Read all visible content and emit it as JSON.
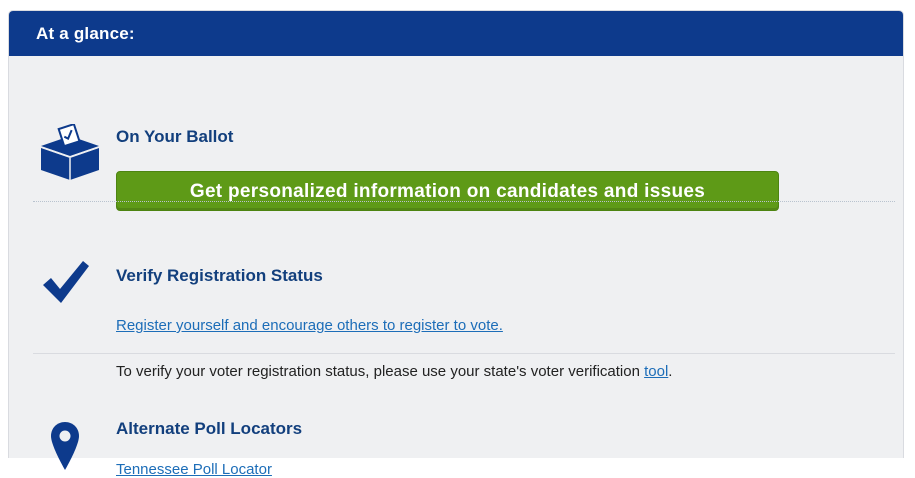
{
  "header": {
    "title": "At a glance:"
  },
  "ballot": {
    "icon": "ballot-box-icon",
    "title": "On Your Ballot",
    "button_label": "Get personalized information on candidates and issues"
  },
  "registration": {
    "icon": "checkmark-icon",
    "title": "Verify Registration Status",
    "register_link": "Register yourself and encourage others to register to vote.",
    "verify_text": "To verify your voter registration status, please use your state's voter verification ",
    "tool_link": "tool",
    "verify_end": "."
  },
  "poll": {
    "icon": "map-pin-icon",
    "title": "Alternate Poll Locators",
    "link": "Tennessee Poll Locator"
  },
  "colors": {
    "header": "#0d3a8c",
    "accent_green": "#5e9a17",
    "heading": "#123f7d",
    "link": "#1c6db8"
  }
}
